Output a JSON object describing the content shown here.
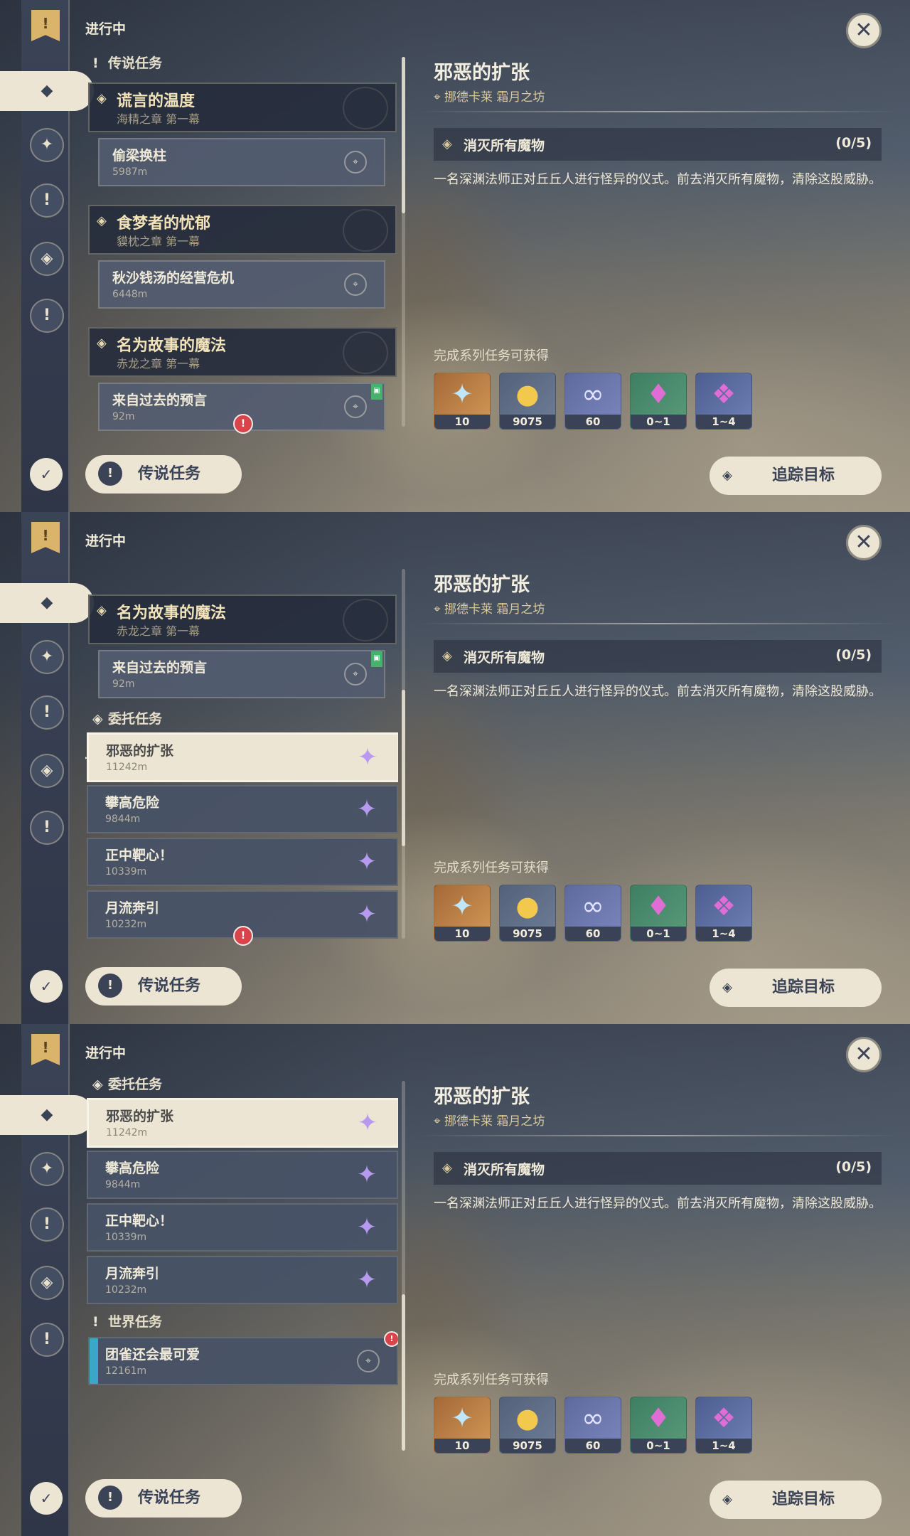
{
  "status": "进行中",
  "section_legend": "传说任务",
  "section_commission": "委托任务",
  "section_world": "世界任务",
  "legend_chapters": [
    {
      "title": "谎言的温度",
      "subtitle": "海精之章 第一幕",
      "sub": {
        "title": "偷梁换柱",
        "dist": "5987m"
      }
    },
    {
      "title": "食梦者的忧郁",
      "subtitle": "貘枕之章 第一幕",
      "sub": {
        "title": "秋沙钱汤的经营危机",
        "dist": "6448m"
      }
    },
    {
      "title": "名为故事的魔法",
      "subtitle": "赤龙之章 第一幕",
      "sub": {
        "title": "来自过去的预言",
        "dist": "92m"
      }
    }
  ],
  "commissions": [
    {
      "title": "邪恶的扩张",
      "dist": "11242m"
    },
    {
      "title": "攀高危险",
      "dist": "9844m"
    },
    {
      "title": "正中靶心！",
      "dist": "10339m"
    },
    {
      "title": "月流奔引",
      "dist": "10232m"
    }
  ],
  "world_quests": [
    {
      "title": "团雀还会最可爱",
      "dist": "12161m"
    }
  ],
  "detail": {
    "title": "邪恶的扩张",
    "location": "挪德卡莱 霜月之坊",
    "objective": "消灭所有魔物",
    "progress": "(0/5)",
    "description": "一名深渊法师正对丘丘人进行怪异的仪式。前去消灭所有魔物，清除这股威胁。",
    "reward_label": "完成系列任务可获得",
    "rewards": [
      {
        "icon": "primogem-icon",
        "count": "10"
      },
      {
        "icon": "mora-icon",
        "count": "9075"
      },
      {
        "icon": "fate-icon",
        "count": "60"
      },
      {
        "icon": "crystal-icon",
        "count": "0~1"
      },
      {
        "icon": "crystal-cluster-icon",
        "count": "1~4"
      }
    ]
  },
  "buttons": {
    "legend": "传说任务",
    "track": "追踪目标"
  }
}
